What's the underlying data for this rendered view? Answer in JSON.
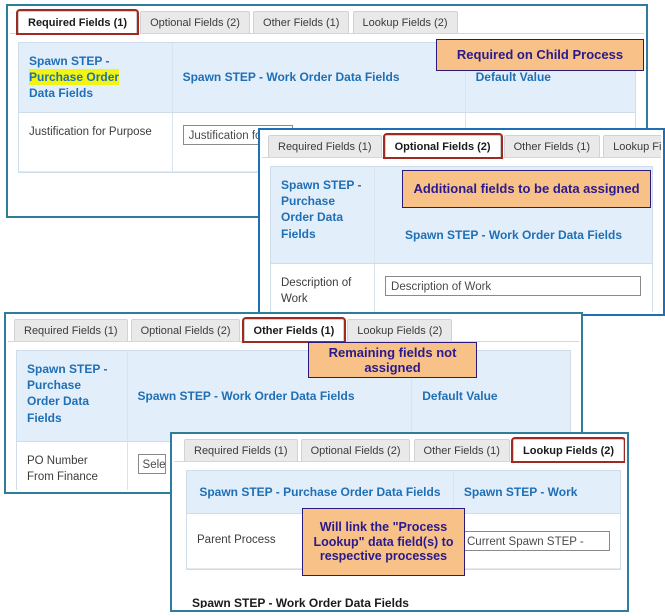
{
  "tabs": {
    "required": "Required Fields (1)",
    "optional": "Optional Fields (2)",
    "other": "Other Fields (1)",
    "lookup": "Lookup Fields (2)"
  },
  "columns": {
    "purchase_order_line1": "Spawn STEP -",
    "purchase_order_line2": "Purchase Order",
    "purchase_order_line3": "Data Fields",
    "purchase_order_full": "Spawn STEP - Purchase Order Data Fields",
    "work_order": "Spawn STEP - Work Order Data Fields",
    "work_order_truncated": "Spawn STEP - Work",
    "default_value": "Default Value"
  },
  "panels": {
    "required": {
      "active_tab": "Required Fields (1)",
      "col_purchase_line1": "Spawn STEP -",
      "col_purchase_line2": "Purchase Order",
      "col_purchase_line3": "Data Fields",
      "col_work_order": "Spawn STEP - Work Order Data Fields",
      "col_default": "Default Value",
      "row_field": "Justification for Purpose",
      "row_value": "Justification fo",
      "callout": "Required on Child Process"
    },
    "optional": {
      "active_tab": "Optional Fields (2)",
      "col_purchase_line1": "Spawn STEP -",
      "col_purchase_line2": "Purchase",
      "col_purchase_line3": "Order Data",
      "col_purchase_line4": "Fields",
      "col_work_order": "Spawn STEP - Work Order Data Fields",
      "row_field": "Description of Work",
      "row_value": "Description of Work",
      "callout": "Additional fields to be data assigned"
    },
    "other": {
      "active_tab": "Other Fields (1)",
      "col_purchase_line1": "Spawn STEP -",
      "col_purchase_line2": "Purchase",
      "col_purchase_line3": "Order Data",
      "col_purchase_line4": "Fields",
      "col_work_order": "Spawn STEP - Work Order Data Fields",
      "col_default": "Default Value",
      "row_field": "PO Number From Finance",
      "row_value": "Sele",
      "callout": "Remaining fields not assigned"
    },
    "lookup": {
      "active_tab": "Lookup Fields (2)",
      "col_purchase": "Spawn STEP - Purchase Order Data Fields",
      "col_work_order": "Spawn STEP - Work",
      "row_field": "Parent Process",
      "row_value": "Current Spawn STEP - ",
      "callout": "Will link the \"Process Lookup\" data field(s) to respective processes",
      "footer_label": "Spawn STEP - Work Order Data Fields"
    }
  },
  "colors": {
    "accent_blue": "#1f6fb5",
    "panel_border": "#1f6fb5",
    "panel_border_teal": "#2e7d9a",
    "header_bg": "#e3eefb",
    "callout_bg": "#f7c188",
    "callout_border": "#2b1a7a",
    "callout_text": "#2a1a8c",
    "tab_highlight": "#9e2a21",
    "highlight_yellow": "#f2f511"
  }
}
